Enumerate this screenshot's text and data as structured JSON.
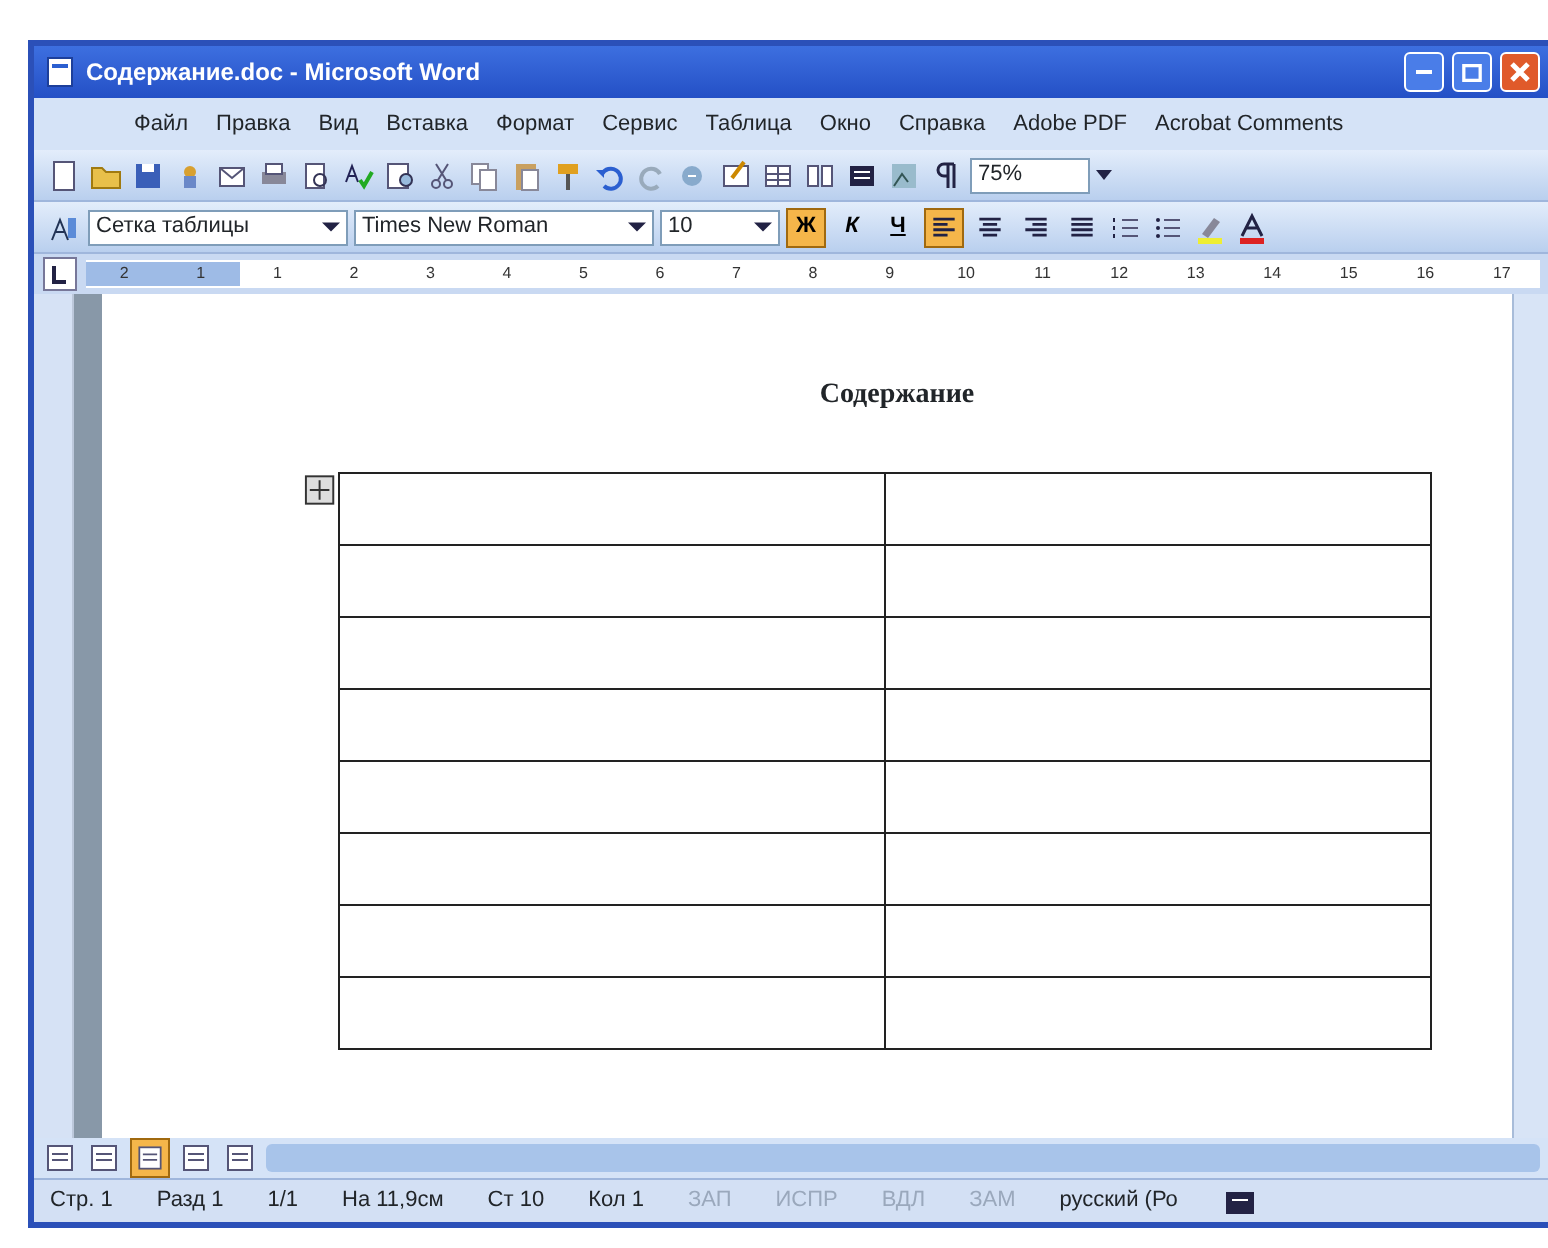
{
  "window": {
    "title": "Содержание.doc - Microsoft Word"
  },
  "menu": [
    "Файл",
    "Правка",
    "Вид",
    "Вставка",
    "Формат",
    "Сервис",
    "Таблица",
    "Окно",
    "Справка",
    "Adobe PDF",
    "Acrobat Comments"
  ],
  "standard_toolbar": {
    "zoom": "75%"
  },
  "formatting_toolbar": {
    "style": "Сетка таблицы",
    "font": "Times New Roman",
    "size": "10",
    "font_buttons": [
      {
        "label": "Ж",
        "selected": true
      },
      {
        "label": "К",
        "selected": false
      },
      {
        "label": "Ч",
        "selected": false
      }
    ],
    "align_buttons": [
      {
        "selected": true
      },
      {
        "selected": false
      },
      {
        "selected": false
      },
      {
        "selected": false
      }
    ]
  },
  "ruler": {
    "numbers": [
      "2",
      "1",
      "1",
      "2",
      "3",
      "4",
      "5",
      "6",
      "7",
      "8",
      "9",
      "10",
      "11",
      "12",
      "13",
      "14",
      "15",
      "16",
      "17"
    ]
  },
  "document": {
    "heading": "Содержание"
  },
  "status_bar": [
    "Стр. 1",
    "Разд 1",
    "1/1",
    "На 11,9см",
    "Ст 10",
    "Кол 1"
  ],
  "status_modes": [
    {
      "label": "ЗАП",
      "on": false
    },
    {
      "label": "ИСПР",
      "on": false
    },
    {
      "label": "ВДЛ",
      "on": false
    },
    {
      "label": "ЗАМ",
      "on": false
    }
  ],
  "language": "русский (Ро"
}
